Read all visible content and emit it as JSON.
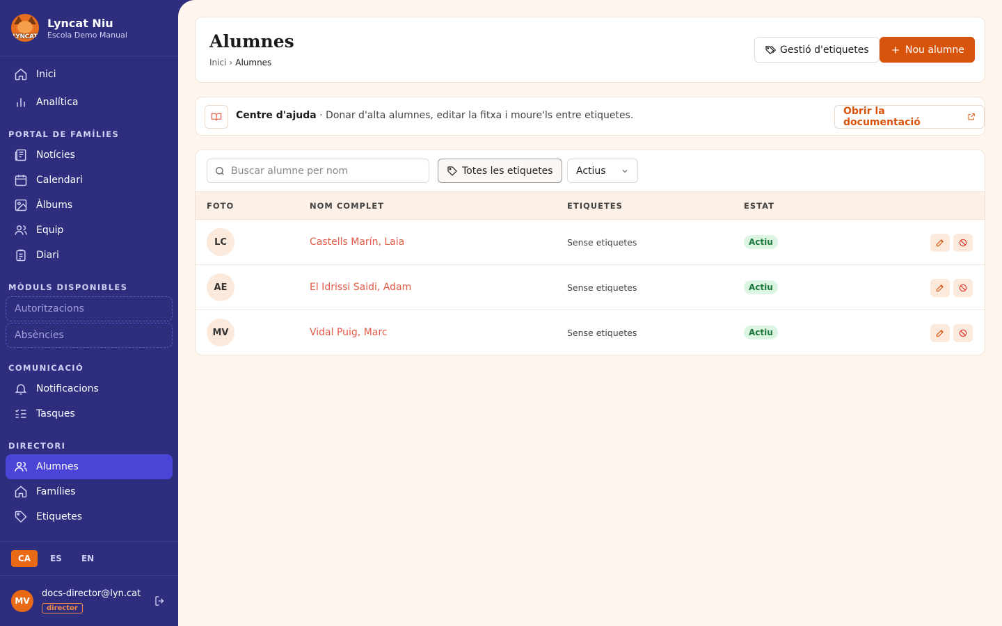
{
  "brand": {
    "title": "Lyncat Niu",
    "subtitle": "Escola Demo Manual",
    "logo_text": "LYNCAT"
  },
  "nav": {
    "top": [
      {
        "label": "Inici",
        "icon": "home-icon"
      },
      {
        "label": "Analítica",
        "icon": "chart-icon"
      }
    ],
    "portal_label": "PORTAL DE FAMÍLIES",
    "portal": [
      {
        "label": "Notícies",
        "icon": "newspaper-icon"
      },
      {
        "label": "Calendari",
        "icon": "calendar-icon"
      },
      {
        "label": "Àlbums",
        "icon": "image-icon"
      },
      {
        "label": "Equip",
        "icon": "users-icon"
      },
      {
        "label": "Diari",
        "icon": "clipboard-icon"
      }
    ],
    "modules_label": "MÒDULS DISPONIBLES",
    "modules": [
      {
        "label": "Autoritzacions"
      },
      {
        "label": "Absències"
      }
    ],
    "comms_label": "COMUNICACIÓ",
    "comms": [
      {
        "label": "Notificacions",
        "icon": "bell-icon"
      },
      {
        "label": "Tasques",
        "icon": "list-check-icon"
      }
    ],
    "directory_label": "DIRECTORI",
    "directory": [
      {
        "label": "Alumnes",
        "icon": "users-icon",
        "active": true
      },
      {
        "label": "Famílies",
        "icon": "home-icon"
      },
      {
        "label": "Etiquetes",
        "icon": "tag-icon"
      }
    ]
  },
  "languages": [
    {
      "code": "CA",
      "active": true
    },
    {
      "code": "ES"
    },
    {
      "code": "EN"
    }
  ],
  "user": {
    "initials": "MV",
    "email": "docs-director@lyn.cat",
    "role": "director"
  },
  "header": {
    "title": "Alumnes",
    "breadcrumb": {
      "home": "Inici",
      "sep": "›",
      "current": "Alumnes"
    },
    "tags_button": "Gestió d'etiquetes",
    "new_button": "Nou alumne"
  },
  "help": {
    "title": "Centre d'ajuda",
    "text": " · Donar d'alta alumnes, editar la fitxa i moure'ls entre etiquetes.",
    "doc_button": "Obrir la documentació"
  },
  "filters": {
    "search_placeholder": "Buscar alumne per nom",
    "tag_filter": "Totes les etiquetes",
    "state_value": "Actius"
  },
  "table": {
    "columns": [
      "FOTO",
      "NOM COMPLET",
      "ETIQUETES",
      "ESTAT"
    ],
    "rows": [
      {
        "initials": "LC",
        "name": "Castells Marín, Laia",
        "tags": "Sense etiquetes",
        "status": "Actiu"
      },
      {
        "initials": "AE",
        "name": "El Idrissi Saidi, Adam",
        "tags": "Sense etiquetes",
        "status": "Actiu"
      },
      {
        "initials": "MV",
        "name": "Vidal Puig, Marc",
        "tags": "Sense etiquetes",
        "status": "Actiu"
      }
    ]
  },
  "colors": {
    "sidebar": "#2f2e7e",
    "active": "#4a45d6",
    "accent": "#d8540c",
    "link": "#e35a45",
    "background": "#fff6ef"
  }
}
